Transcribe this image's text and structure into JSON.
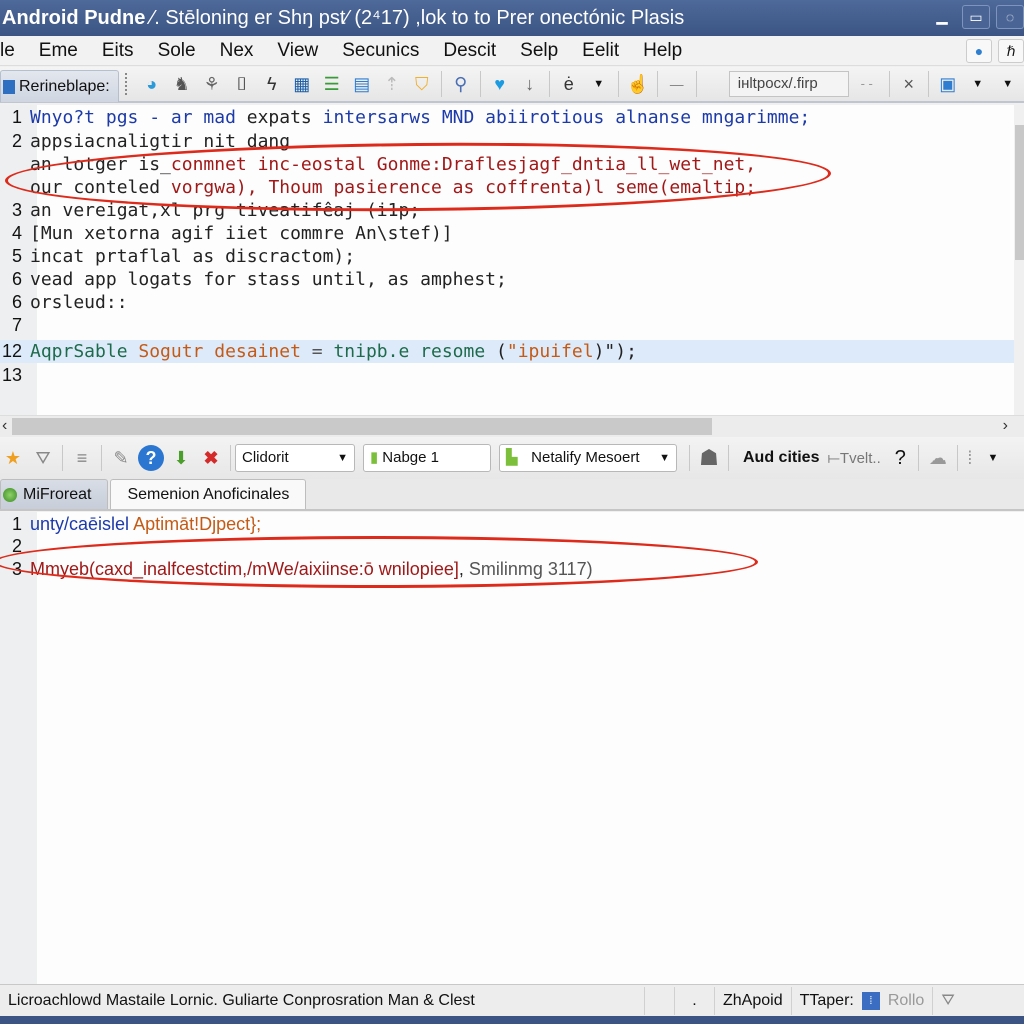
{
  "window": {
    "title_app": "Android Pudne",
    "title_rest": " ⁄. Stēloning er Shŋ pst⁄ (2⁴17) ,lok to to Prer onectónic Plasis",
    "controls": [
      "minimize",
      "maximize",
      "close"
    ]
  },
  "menubar": {
    "items": [
      "le",
      "Eme",
      "Eits",
      "Sole",
      "Nex",
      "View",
      "Secunics",
      "Descit",
      "Selp",
      "Eelit",
      "Help"
    ],
    "right_icons": [
      "globe-icon",
      "font-icon"
    ]
  },
  "toolbar1": {
    "perspective_label": "Rerineblape:",
    "search_value": "iнltpocx/.firp",
    "more_label": "- -",
    "close_label": "×"
  },
  "editor_top": {
    "lines": [
      {
        "num": "1",
        "segments": [
          {
            "t": "Wnyo?t pgs - ar mad ",
            "c": "blue"
          },
          {
            "t": "expats ",
            "c": "dark"
          },
          {
            "t": "intersarws MND abiirotious alnanse mngarimme;",
            "c": "blue"
          }
        ]
      },
      {
        "num": "2",
        "segments": [
          {
            "t": "appsiacnaligtir nit dang",
            "c": "dark"
          }
        ]
      },
      {
        "num": "",
        "segments": [
          {
            "t": "an lotger is_",
            "c": "dark"
          },
          {
            "t": "conmnet inc-eostal ",
            "c": "red"
          },
          {
            "t": "Gonme:Draflesjagf_dntia_ll_wet_net,",
            "c": "red"
          }
        ]
      },
      {
        "num": "",
        "segments": [
          {
            "t": "our conteled ",
            "c": "dark"
          },
          {
            "t": "vorgwa), ",
            "c": "red"
          },
          {
            "t": "Thoum pasierence as coffrenta)l seme(emaltip;",
            "c": "red"
          }
        ]
      },
      {
        "num": "3",
        "segments": [
          {
            "t": "an vereigat,xl prg tiveatifêaj (i1p;",
            "c": "dark"
          }
        ]
      },
      {
        "num": "4",
        "segments": [
          {
            "t": "[Mun xetorna agif iiet commre An\\stef)]",
            "c": "dark"
          }
        ]
      },
      {
        "num": "5",
        "segments": [
          {
            "t": "incat prtaflal as discractom);",
            "c": "dark"
          }
        ]
      },
      {
        "num": "6",
        "segments": [
          {
            "t": "vead app logats for stass until, as amphest;",
            "c": "dark"
          }
        ]
      },
      {
        "num": "6",
        "segments": [
          {
            "t": "orsleud::",
            "c": "dark"
          }
        ]
      },
      {
        "num": "7",
        "segments": []
      },
      {
        "num": "12",
        "highlight": true,
        "segments": [
          {
            "t": "AqprSable ",
            "c": "green"
          },
          {
            "t": "Sogutr desainet ",
            "c": "orange"
          },
          {
            "t": "= ",
            "c": "gray"
          },
          {
            "t": "tnipb.e resome ",
            "c": "green"
          },
          {
            "t": "(",
            "c": "dark"
          },
          {
            "t": "\"ipuifel",
            "c": "orange"
          },
          {
            "t": ")\");",
            "c": "dark"
          }
        ]
      },
      {
        "num": "13",
        "segments": []
      }
    ]
  },
  "toolbar2": {
    "combo1": "Clidorit",
    "combo2": "Nabge 1",
    "combo3": "Netalify Mesoert",
    "label_bold": "Aud cities",
    "label_light": "⟝Tvelt..",
    "help": "?"
  },
  "tabs2": {
    "items": [
      {
        "label": "MiFroreat",
        "active": false
      },
      {
        "label": "Semenion Anoficinales",
        "active": true
      }
    ]
  },
  "editor_bottom": {
    "lines": [
      {
        "num": "1",
        "segments": [
          {
            "t": "unty/caēislel ",
            "c": "blue"
          },
          {
            "t": "Aptimāt!Djpect};",
            "c": "orange"
          }
        ]
      },
      {
        "num": "2",
        "segments": []
      },
      {
        "num": "3",
        "segments": [
          {
            "t": "Mmyeb(",
            "c": "red"
          },
          {
            "t": "caxd_inalfcestctim,/mWe/aixiinse:ō wnilopiee]",
            "c": "red"
          },
          {
            "t": ", ",
            "c": "dark"
          },
          {
            "t": "Smilinmg 3117)",
            "c": "gray"
          }
        ]
      }
    ]
  },
  "statusbar": {
    "message": "Licroachlowd Mastaile Lornic. Guliarte Conprosration Man & Clest",
    "dot": ".",
    "mode": "ZhApoid",
    "taper_label": "TTaper:",
    "taper_value": "Rollo"
  },
  "colors": {
    "titlebar": "#3b5483",
    "annotation": "#dd2a1a",
    "highlight_line": "#ddeafa"
  }
}
